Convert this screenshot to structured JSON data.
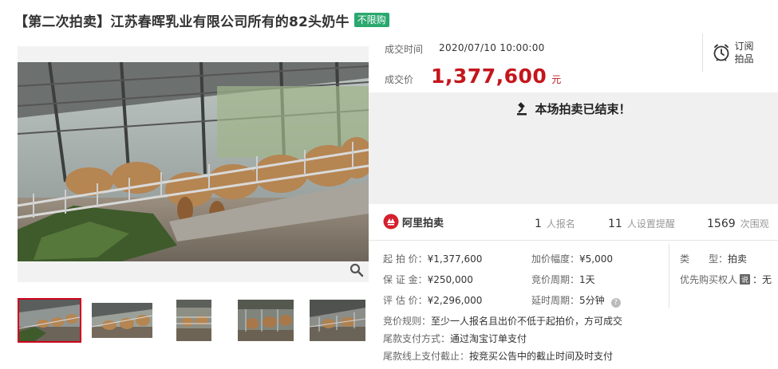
{
  "title": {
    "text": "【第二次拍卖】江苏春晖乳业有限公司所有的82头奶牛",
    "badge": "不限购"
  },
  "deal": {
    "time_label": "成交时间",
    "time_value": "2020/07/10 10:00:00",
    "price_label": "成交价",
    "price_value": "1,377,600",
    "price_unit": "元"
  },
  "subscribe": {
    "line1": "订阅",
    "line2": "拍品",
    "icon": "alarm-clock-icon"
  },
  "status": {
    "message": "本场拍卖已结束！",
    "icon": "gavel-icon"
  },
  "brand": {
    "name": "阿里拍卖",
    "icon": "ali-auction-logo"
  },
  "stats": [
    {
      "count": "1",
      "label": "人报名"
    },
    {
      "count": "11",
      "label": "人设置提醒"
    },
    {
      "count": "1569",
      "label": "次围观"
    }
  ],
  "details": {
    "start_price_label": "起 拍 价：",
    "start_price": "¥1,377,600",
    "deposit_label": "保 证 金：",
    "deposit": "¥250,000",
    "appraisal_label": "评 估 价：",
    "appraisal": "¥2,296,000",
    "increment_label": "加价幅度：",
    "increment": "¥5,000",
    "cycle_label": "竞价周期：",
    "cycle": "1天",
    "delay_label": "延时周期：",
    "delay": "5分钟",
    "type_label": "类　　型：",
    "type": "拍卖",
    "priority_label": "优先购买权人",
    "priority_tag": "说",
    "priority": "：无",
    "rule_label": "竞价规则：",
    "rule": "至少一人报名且出价不低于起拍价，方可成交",
    "pay_label": "尾款支付方式：",
    "pay": "通过淘宝订单支付",
    "deadline_label": "尾款线上支付截止：",
    "deadline": "按竞买公告中的截止时间及时支付"
  },
  "thumbnails": [
    {
      "name": "thumb-1",
      "active": true
    },
    {
      "name": "thumb-2",
      "active": false
    },
    {
      "name": "thumb-3",
      "active": false
    },
    {
      "name": "thumb-4",
      "active": false
    },
    {
      "name": "thumb-5",
      "active": false
    }
  ],
  "colors": {
    "price_red": "#c4161c",
    "badge_green": "#2aa86e",
    "panel_gray": "#f0f0f0"
  }
}
